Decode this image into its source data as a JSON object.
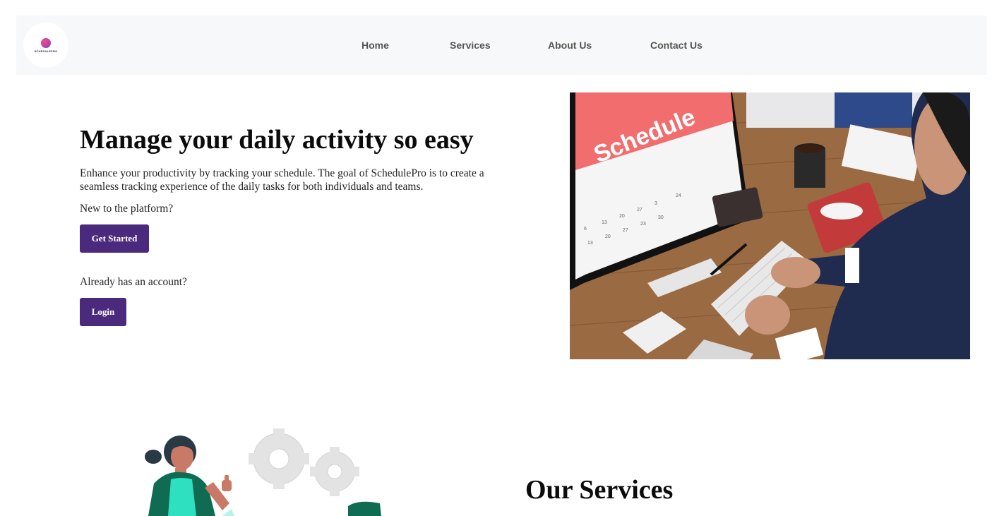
{
  "nav": {
    "logo_text": "SCHEDULEPRO",
    "links": [
      "Home",
      "Services",
      "About Us",
      "Contact Us"
    ]
  },
  "hero": {
    "title": "Manage your daily activity so easy",
    "description": "Enhance your productivity by tracking your schedule. The goal of SchedulePro is to create a seamless tracking experience of the daily tasks for both individuals and teams.",
    "new_prompt": "New to the platform?",
    "get_started_label": "Get Started",
    "account_prompt": "Already has an account?",
    "login_label": "Login",
    "image_text": "Schedule"
  },
  "services": {
    "title": "Our Services"
  },
  "colors": {
    "nav_bg": "#f7f8f9",
    "button_bg": "#4b2a7d",
    "schedule_header": "#f26d6d"
  }
}
